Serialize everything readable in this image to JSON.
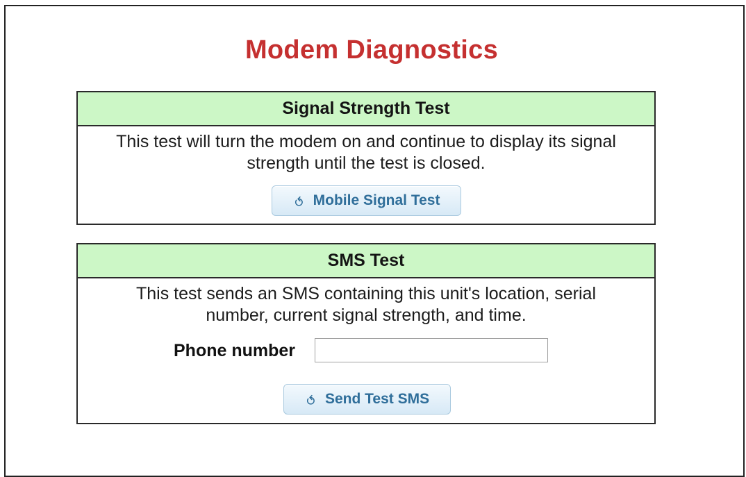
{
  "page": {
    "title": "Modem Diagnostics"
  },
  "signal_test": {
    "header": "Signal Strength Test",
    "description": "This test will turn the modem on and continue to display its signal strength until the test is closed.",
    "button_label": "Mobile Signal Test",
    "button_icon": "refresh-icon"
  },
  "sms_test": {
    "header": "SMS Test",
    "description": "This test sends an SMS containing this unit's location, serial number, current signal strength, and time.",
    "phone_label": "Phone number",
    "phone_value": "",
    "phone_placeholder": "",
    "button_label": "Send Test SMS",
    "button_icon": "refresh-icon"
  },
  "colors": {
    "title": "#c53030",
    "panel_header_bg": "#ccf7c6",
    "button_text": "#2f6e9a"
  }
}
